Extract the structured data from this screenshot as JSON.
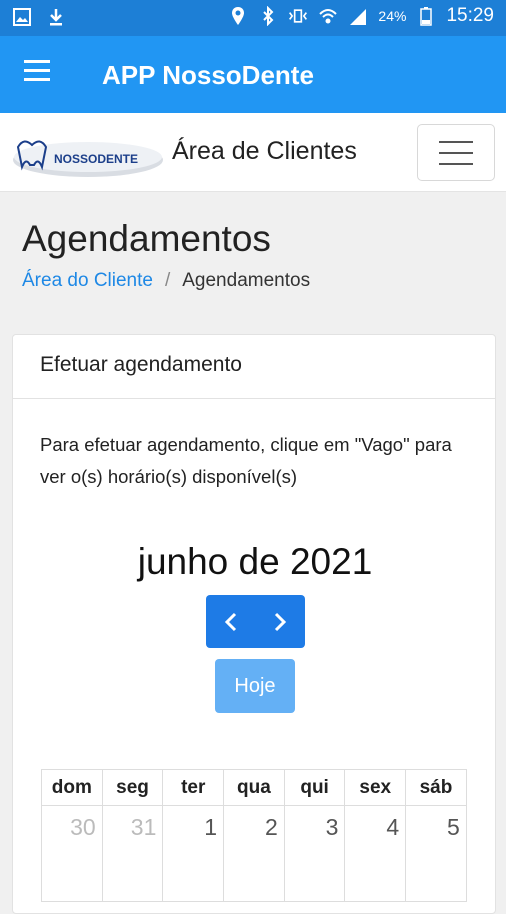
{
  "status_bar": {
    "battery": "24%",
    "time": "15:29"
  },
  "app_bar": {
    "title": "APP NossoDente"
  },
  "site_nav": {
    "logo_text": "NOSSODENTE",
    "brand": "Área de Clientes"
  },
  "page": {
    "title": "Agendamentos",
    "breadcrumb": {
      "home": "Área do Cliente",
      "separator": "/",
      "current": "Agendamentos"
    }
  },
  "card": {
    "header": "Efetuar agendamento",
    "instructions": "Para efetuar agendamento, clique em \"Vago\" para ver o(s) horário(s) disponível(s)"
  },
  "calendar": {
    "month_title": "junho de 2021",
    "today_label": "Hoje",
    "weekdays": [
      "dom",
      "seg",
      "ter",
      "qua",
      "qui",
      "sex",
      "sáb"
    ],
    "first_week": [
      "30",
      "31",
      "1",
      "2",
      "3",
      "4",
      "5"
    ]
  },
  "colors": {
    "status_bar": "#1d7fd6",
    "app_bar": "#2196f3",
    "primary": "#1e7be6",
    "link": "#1e88e5"
  }
}
